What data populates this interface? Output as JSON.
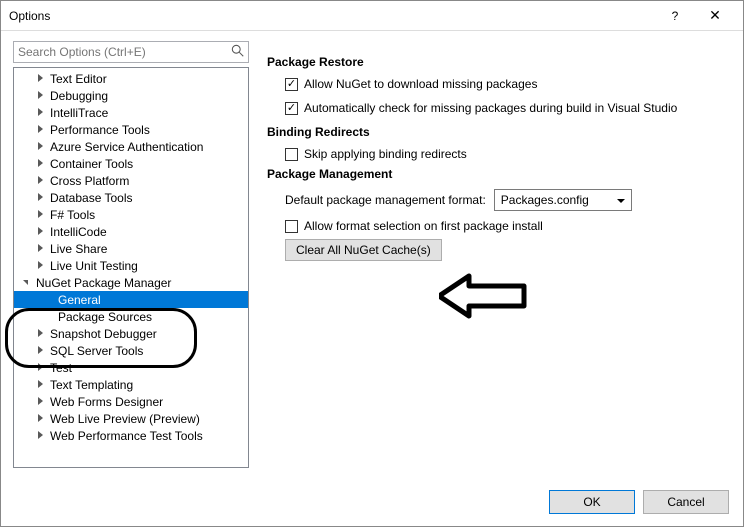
{
  "window": {
    "title": "Options"
  },
  "search": {
    "placeholder": "Search Options (Ctrl+E)"
  },
  "tree": {
    "items": [
      {
        "label": "Text Editor"
      },
      {
        "label": "Debugging"
      },
      {
        "label": "IntelliTrace"
      },
      {
        "label": "Performance Tools"
      },
      {
        "label": "Azure Service Authentication"
      },
      {
        "label": "Container Tools"
      },
      {
        "label": "Cross Platform"
      },
      {
        "label": "Database Tools"
      },
      {
        "label": "F# Tools"
      },
      {
        "label": "IntelliCode"
      },
      {
        "label": "Live Share"
      },
      {
        "label": "Live Unit Testing"
      },
      {
        "label": "NuGet Package Manager"
      },
      {
        "label": "General"
      },
      {
        "label": "Package Sources"
      },
      {
        "label": "Snapshot Debugger"
      },
      {
        "label": "SQL Server Tools"
      },
      {
        "label": "Test"
      },
      {
        "label": "Text Templating"
      },
      {
        "label": "Web Forms Designer"
      },
      {
        "label": "Web Live Preview (Preview)"
      },
      {
        "label": "Web Performance Test Tools"
      }
    ]
  },
  "sections": {
    "packageRestore": {
      "title": "Package Restore",
      "allowDownload": "Allow NuGet to download missing packages",
      "autoCheck": "Automatically check for missing packages during build in Visual Studio"
    },
    "bindingRedirects": {
      "title": "Binding Redirects",
      "skip": "Skip applying binding redirects"
    },
    "packageManagement": {
      "title": "Package Management",
      "defaultFormat": "Default package management format:",
      "formatValue": "Packages.config",
      "allowSelection": "Allow format selection on first package install",
      "clearCache": "Clear All NuGet Cache(s)"
    }
  },
  "footer": {
    "ok": "OK",
    "cancel": "Cancel"
  }
}
